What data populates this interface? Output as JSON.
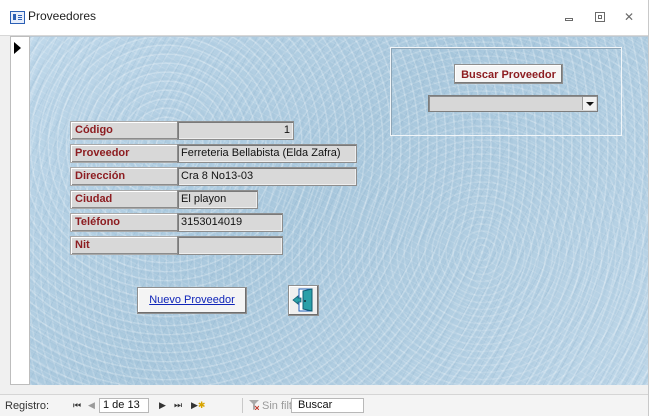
{
  "window": {
    "title": "Proveedores",
    "controls": {
      "close_glyph": "✕"
    }
  },
  "form": {
    "fields": [
      {
        "label": "Código",
        "value": "1"
      },
      {
        "label": "Proveedor",
        "value": "Ferreteria Bellabista (Elda Zafra)"
      },
      {
        "label": "Dirección",
        "value": "Cra 8 No13-03"
      },
      {
        "label": "Ciudad",
        "value": "El playon"
      },
      {
        "label": "Teléfono",
        "value": "3153014019"
      },
      {
        "label": "Nit",
        "value": ""
      }
    ],
    "search_button_label": "Buscar Proveedor",
    "search_combo_value": "",
    "new_button_label": "Nuevo Proveedor",
    "exit_icon": "exit-door-icon"
  },
  "navigation": {
    "record_label": "Registro:",
    "current": "1 de 13",
    "filter_label": "Sin filtro",
    "search_label": "Buscar",
    "icons": [
      "first-record-icon",
      "previous-record-icon",
      "next-record-icon",
      "last-record-icon",
      "new-record-icon",
      "filter-icon"
    ]
  },
  "colors": {
    "label_text": "#8d1d21",
    "link_text": "#0f24b8",
    "background": "#b7d3e6"
  }
}
